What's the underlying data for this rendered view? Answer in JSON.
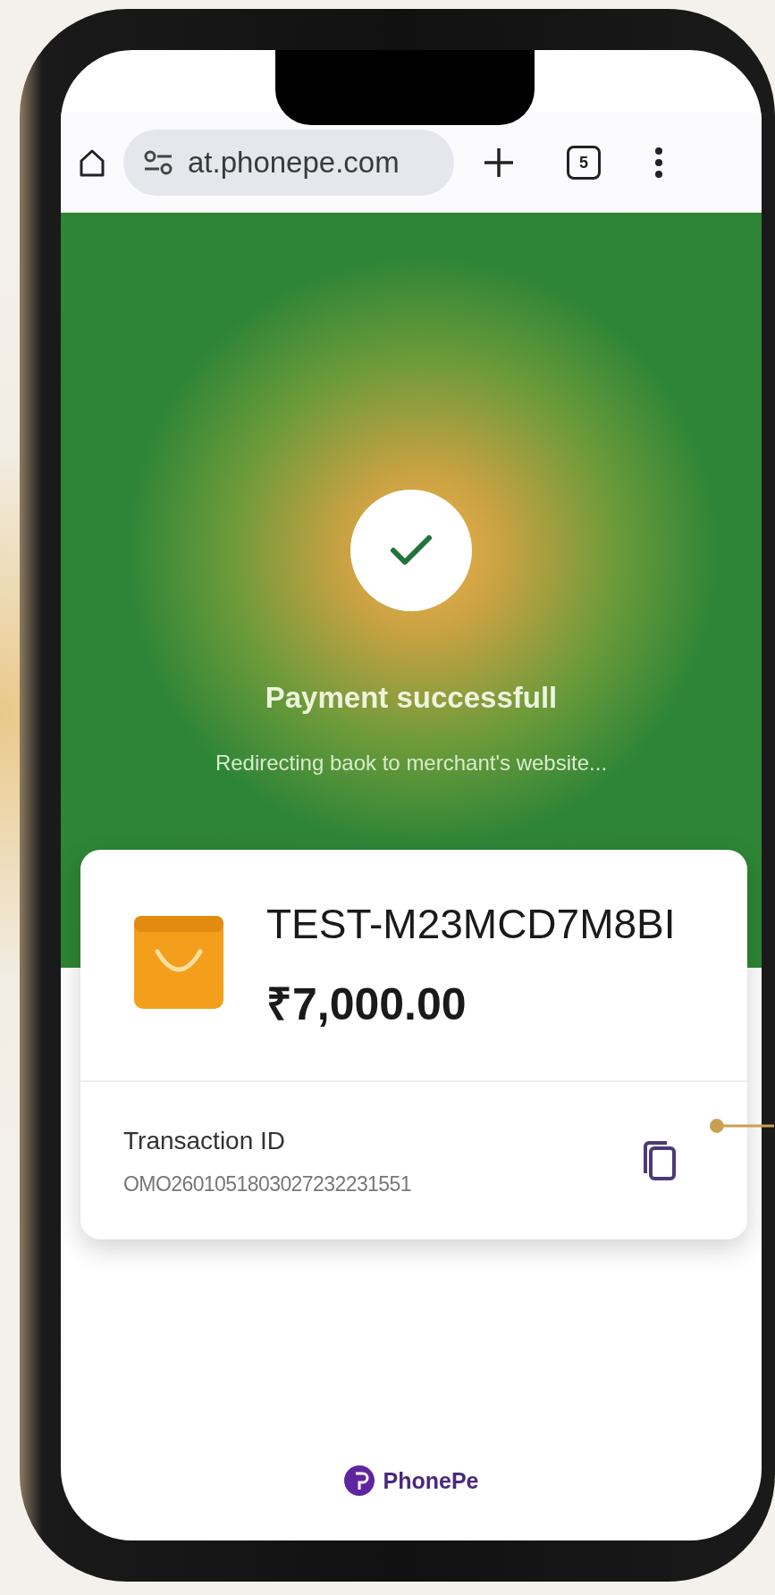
{
  "browser": {
    "url": "at.phonepe.com",
    "tab_count": "5"
  },
  "status": {
    "title": "Payment successfull",
    "subtitle": "Redirecting baok to merchant's website..."
  },
  "order": {
    "merchant_ref": "TEST-M23MCD7M8BI",
    "amount": "₹7,000.00"
  },
  "transaction": {
    "label": "Transaction ID",
    "id": "OMO2601051803027232231551"
  },
  "footer": {
    "brand": "PhonePe"
  }
}
